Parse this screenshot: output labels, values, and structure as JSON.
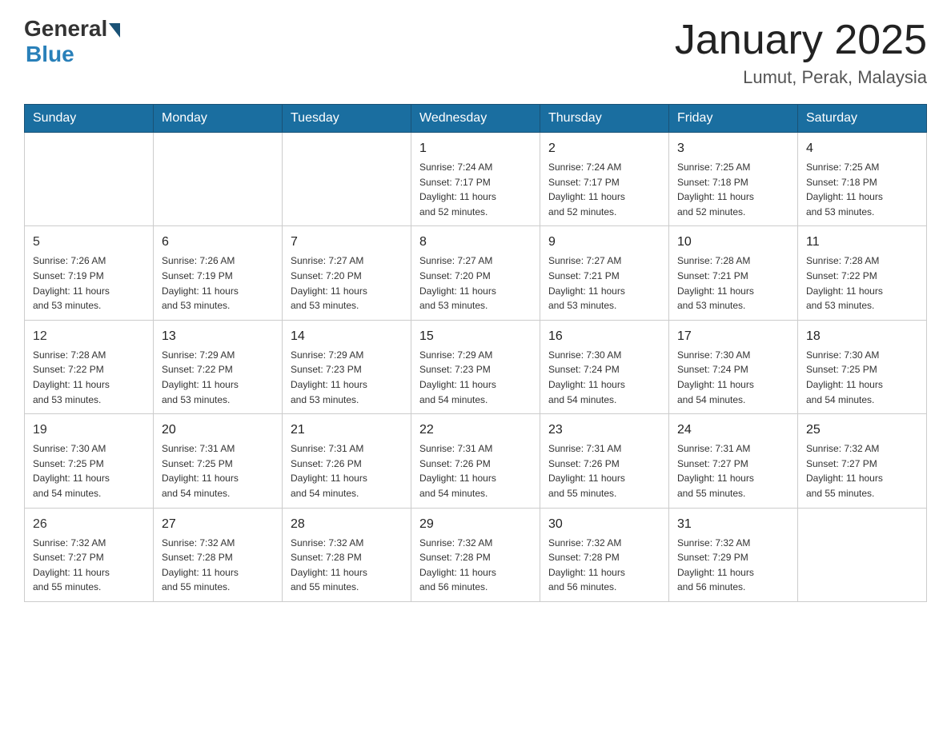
{
  "header": {
    "logo_general": "General",
    "logo_blue": "Blue",
    "month_title": "January 2025",
    "location": "Lumut, Perak, Malaysia"
  },
  "weekdays": [
    "Sunday",
    "Monday",
    "Tuesday",
    "Wednesday",
    "Thursday",
    "Friday",
    "Saturday"
  ],
  "weeks": [
    [
      {
        "day": "",
        "content": ""
      },
      {
        "day": "",
        "content": ""
      },
      {
        "day": "",
        "content": ""
      },
      {
        "day": "1",
        "content": "Sunrise: 7:24 AM\nSunset: 7:17 PM\nDaylight: 11 hours\nand 52 minutes."
      },
      {
        "day": "2",
        "content": "Sunrise: 7:24 AM\nSunset: 7:17 PM\nDaylight: 11 hours\nand 52 minutes."
      },
      {
        "day": "3",
        "content": "Sunrise: 7:25 AM\nSunset: 7:18 PM\nDaylight: 11 hours\nand 52 minutes."
      },
      {
        "day": "4",
        "content": "Sunrise: 7:25 AM\nSunset: 7:18 PM\nDaylight: 11 hours\nand 53 minutes."
      }
    ],
    [
      {
        "day": "5",
        "content": "Sunrise: 7:26 AM\nSunset: 7:19 PM\nDaylight: 11 hours\nand 53 minutes."
      },
      {
        "day": "6",
        "content": "Sunrise: 7:26 AM\nSunset: 7:19 PM\nDaylight: 11 hours\nand 53 minutes."
      },
      {
        "day": "7",
        "content": "Sunrise: 7:27 AM\nSunset: 7:20 PM\nDaylight: 11 hours\nand 53 minutes."
      },
      {
        "day": "8",
        "content": "Sunrise: 7:27 AM\nSunset: 7:20 PM\nDaylight: 11 hours\nand 53 minutes."
      },
      {
        "day": "9",
        "content": "Sunrise: 7:27 AM\nSunset: 7:21 PM\nDaylight: 11 hours\nand 53 minutes."
      },
      {
        "day": "10",
        "content": "Sunrise: 7:28 AM\nSunset: 7:21 PM\nDaylight: 11 hours\nand 53 minutes."
      },
      {
        "day": "11",
        "content": "Sunrise: 7:28 AM\nSunset: 7:22 PM\nDaylight: 11 hours\nand 53 minutes."
      }
    ],
    [
      {
        "day": "12",
        "content": "Sunrise: 7:28 AM\nSunset: 7:22 PM\nDaylight: 11 hours\nand 53 minutes."
      },
      {
        "day": "13",
        "content": "Sunrise: 7:29 AM\nSunset: 7:22 PM\nDaylight: 11 hours\nand 53 minutes."
      },
      {
        "day": "14",
        "content": "Sunrise: 7:29 AM\nSunset: 7:23 PM\nDaylight: 11 hours\nand 53 minutes."
      },
      {
        "day": "15",
        "content": "Sunrise: 7:29 AM\nSunset: 7:23 PM\nDaylight: 11 hours\nand 54 minutes."
      },
      {
        "day": "16",
        "content": "Sunrise: 7:30 AM\nSunset: 7:24 PM\nDaylight: 11 hours\nand 54 minutes."
      },
      {
        "day": "17",
        "content": "Sunrise: 7:30 AM\nSunset: 7:24 PM\nDaylight: 11 hours\nand 54 minutes."
      },
      {
        "day": "18",
        "content": "Sunrise: 7:30 AM\nSunset: 7:25 PM\nDaylight: 11 hours\nand 54 minutes."
      }
    ],
    [
      {
        "day": "19",
        "content": "Sunrise: 7:30 AM\nSunset: 7:25 PM\nDaylight: 11 hours\nand 54 minutes."
      },
      {
        "day": "20",
        "content": "Sunrise: 7:31 AM\nSunset: 7:25 PM\nDaylight: 11 hours\nand 54 minutes."
      },
      {
        "day": "21",
        "content": "Sunrise: 7:31 AM\nSunset: 7:26 PM\nDaylight: 11 hours\nand 54 minutes."
      },
      {
        "day": "22",
        "content": "Sunrise: 7:31 AM\nSunset: 7:26 PM\nDaylight: 11 hours\nand 54 minutes."
      },
      {
        "day": "23",
        "content": "Sunrise: 7:31 AM\nSunset: 7:26 PM\nDaylight: 11 hours\nand 55 minutes."
      },
      {
        "day": "24",
        "content": "Sunrise: 7:31 AM\nSunset: 7:27 PM\nDaylight: 11 hours\nand 55 minutes."
      },
      {
        "day": "25",
        "content": "Sunrise: 7:32 AM\nSunset: 7:27 PM\nDaylight: 11 hours\nand 55 minutes."
      }
    ],
    [
      {
        "day": "26",
        "content": "Sunrise: 7:32 AM\nSunset: 7:27 PM\nDaylight: 11 hours\nand 55 minutes."
      },
      {
        "day": "27",
        "content": "Sunrise: 7:32 AM\nSunset: 7:28 PM\nDaylight: 11 hours\nand 55 minutes."
      },
      {
        "day": "28",
        "content": "Sunrise: 7:32 AM\nSunset: 7:28 PM\nDaylight: 11 hours\nand 55 minutes."
      },
      {
        "day": "29",
        "content": "Sunrise: 7:32 AM\nSunset: 7:28 PM\nDaylight: 11 hours\nand 56 minutes."
      },
      {
        "day": "30",
        "content": "Sunrise: 7:32 AM\nSunset: 7:28 PM\nDaylight: 11 hours\nand 56 minutes."
      },
      {
        "day": "31",
        "content": "Sunrise: 7:32 AM\nSunset: 7:29 PM\nDaylight: 11 hours\nand 56 minutes."
      },
      {
        "day": "",
        "content": ""
      }
    ]
  ]
}
